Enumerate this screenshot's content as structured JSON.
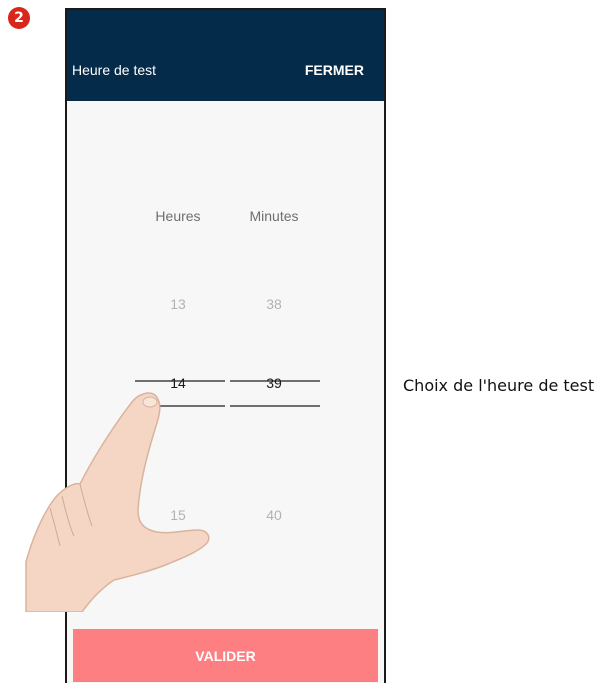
{
  "step": "2",
  "header": {
    "title": "Heure de test",
    "close_label": "FERMER"
  },
  "picker": {
    "hours": {
      "label": "Heures",
      "prev": "13",
      "selected": "14",
      "next": "15"
    },
    "minutes": {
      "label": "Minutes",
      "prev": "38",
      "selected": "39",
      "next": "40"
    }
  },
  "actions": {
    "validate_label": "VALIDER"
  },
  "caption": "Choix de l'heure de test",
  "colors": {
    "header": "#052b4a",
    "button": "#fd7f82",
    "badge": "#d9261c"
  }
}
